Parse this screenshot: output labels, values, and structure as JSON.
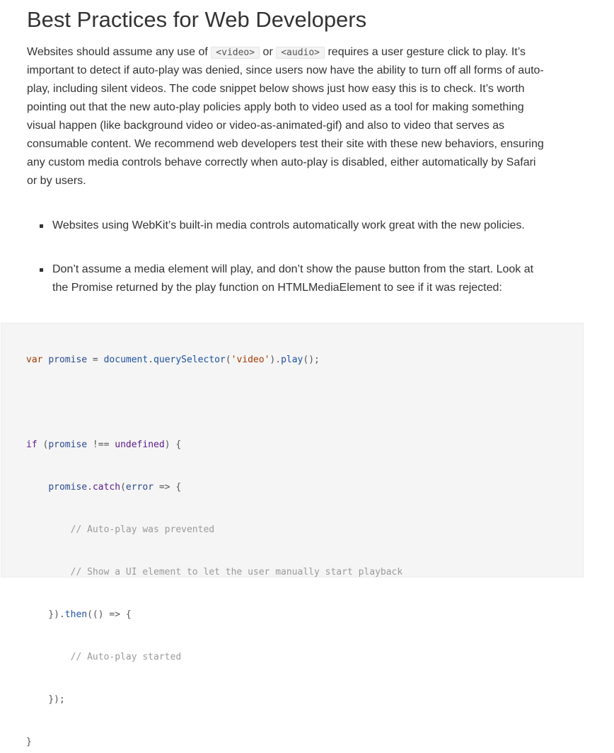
{
  "heading": "Best Practices for Web Developers",
  "intro": {
    "line1_a": "Websites should assume any use of ",
    "code_video": "<video>",
    "line1_b": " or ",
    "code_audio": "<audio>",
    "line1_c": " requires a user gesture click to play. It’s",
    "lines": [
      "important to detect if auto-play was denied, since users now have the ability to turn off all forms of auto-",
      "play, including silent videos. The code snippet below shows just how easy this is to check. It’s worth",
      "pointing out that the new auto-play policies apply both to video used as a tool for making something",
      "visual happen (like background video or video-as-animated-gif) and also to video that serves as",
      "consumable content. We recommend web developers test their site with these new behaviors, ensuring",
      "any custom media controls behave correctly when auto-play is disabled, either automatically by Safari",
      "or by users."
    ]
  },
  "bullets": [
    {
      "lines": [
        "Websites using WebKit’s built-in media controls automatically work great with the new policies."
      ]
    },
    {
      "lines": [
        "Don’t assume a media element will play, and don’t show the pause button from the start. Look at",
        "the Promise returned by the play function on HTMLMediaElement to see if it was rejected:"
      ]
    }
  ],
  "code": {
    "l1": {
      "kw": "var",
      "v": "promise",
      "eq": " = ",
      "obj": "document",
      "dot1": ".",
      "fn1": "querySelector",
      "p1": "(",
      "str": "'video'",
      "p2": ").",
      "fn2": "play",
      "end": "();"
    },
    "l3": {
      "kw": "if",
      "p1": " (",
      "v": "promise",
      "op": " !== ",
      "u": "undefined",
      "p2": ") {"
    },
    "l4": {
      "ind": "    ",
      "v": "promise",
      "dot": ".",
      "fn": "catch",
      "p1": "(",
      "arg": "error",
      "arrow": " => {"
    },
    "l5": "        // Auto-play was prevented",
    "l6": "        // Show a UI element to let the user manually start playback",
    "l7": {
      "a": "    }).",
      "fn": "then",
      "b": "(() => {"
    },
    "l8": "        // Auto-play started",
    "l9": "    });",
    "l10": "}"
  }
}
